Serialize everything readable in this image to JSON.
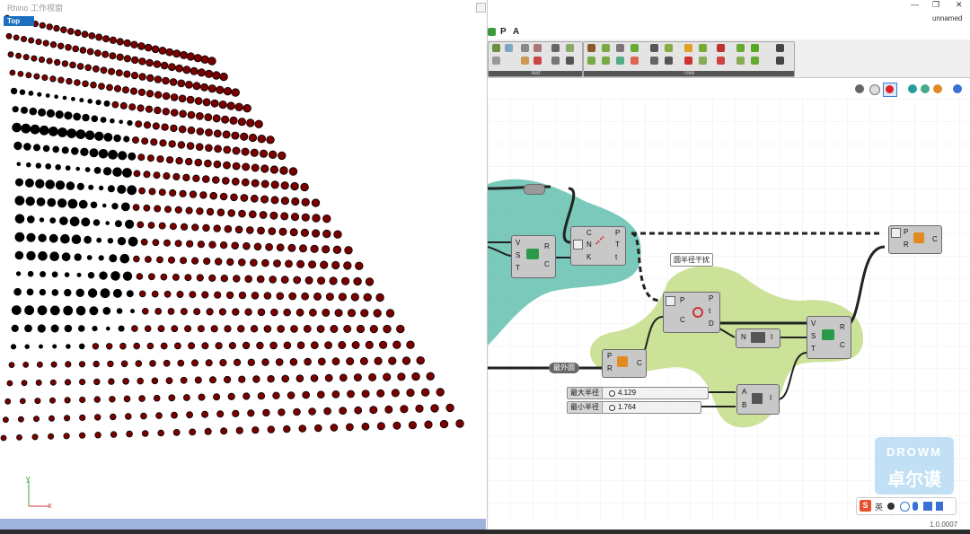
{
  "rhino": {
    "title": "Rhino 工作视窗",
    "viewport_label": "Top",
    "axis_y": "y",
    "axis_x": "x"
  },
  "grasshopper": {
    "doc_name": "unnamed",
    "menu": [
      "P",
      "A"
    ],
    "toolbar_groups": [
      "Text",
      "Tree"
    ],
    "version": "1.0.0007"
  },
  "components": {
    "panel_label": "圆半径干扰",
    "top_left": {
      "inputs": [
        "C",
        "N",
        "K"
      ],
      "outputs": [
        "P",
        "T",
        "t"
      ]
    },
    "swc1": {
      "inputs": [
        "V",
        "S",
        "T"
      ],
      "outputs": [
        "R",
        "C"
      ]
    },
    "circle1": {
      "inputs": [
        "P",
        "R"
      ],
      "outputs": [
        "C"
      ]
    },
    "closest": {
      "inputs": [
        "P",
        "C"
      ],
      "outputs": [
        "P",
        "t",
        "D"
      ]
    },
    "number": {
      "inputs": [
        "N"
      ],
      "outputs": [
        "I"
      ]
    },
    "swc2": {
      "inputs": [
        "V",
        "S",
        "T"
      ],
      "outputs": [
        "R",
        "C"
      ]
    },
    "circle2": {
      "inputs": [
        "P",
        "R"
      ],
      "outputs": [
        "C"
      ]
    },
    "bounds": {
      "inputs": [
        "A",
        "B"
      ],
      "outputs": [
        "I"
      ]
    },
    "outer_circle_label": "最外圆"
  },
  "sliders": [
    {
      "label": "最大半径",
      "value": "4.129"
    },
    {
      "label": "最小半径",
      "value": "1.764"
    }
  ],
  "watermark": {
    "en": "DROWM",
    "cn": "卓尔谟"
  },
  "ime": {
    "lang": "英"
  },
  "colors": {
    "dot_black": "#000000",
    "dot_red": "#7a0000",
    "group_teal": "#6cc3b3",
    "group_green": "#c7df8e",
    "accent_blue": "#1c6fbe"
  }
}
